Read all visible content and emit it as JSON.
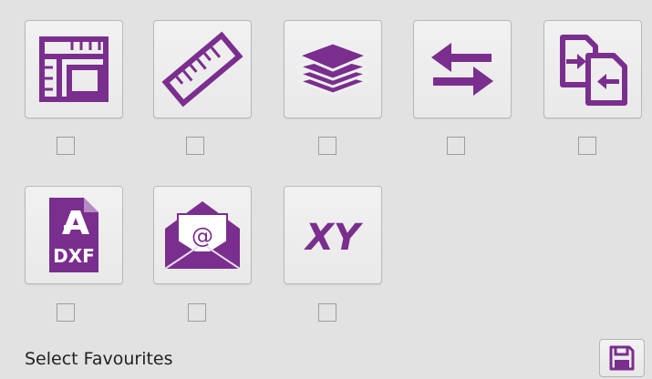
{
  "accent_color": "#7a2e8e",
  "tiles": [
    {
      "icon": "layout-ruler-icon",
      "checked": false
    },
    {
      "icon": "ruler-icon",
      "checked": false
    },
    {
      "icon": "layers-icon",
      "checked": false
    },
    {
      "icon": "swap-arrows-icon",
      "checked": false
    },
    {
      "icon": "document-transfer-icon",
      "checked": false
    },
    {
      "icon": "dxf-file-icon",
      "dxf_label": "DXF",
      "checked": false
    },
    {
      "icon": "email-envelope-icon",
      "at_label": "@",
      "checked": false
    },
    {
      "icon": "xy-coordinates-icon",
      "xy_label": "XY",
      "checked": false
    }
  ],
  "footer": {
    "label": "Select Favourites",
    "save_icon": "floppy-disk-icon"
  }
}
